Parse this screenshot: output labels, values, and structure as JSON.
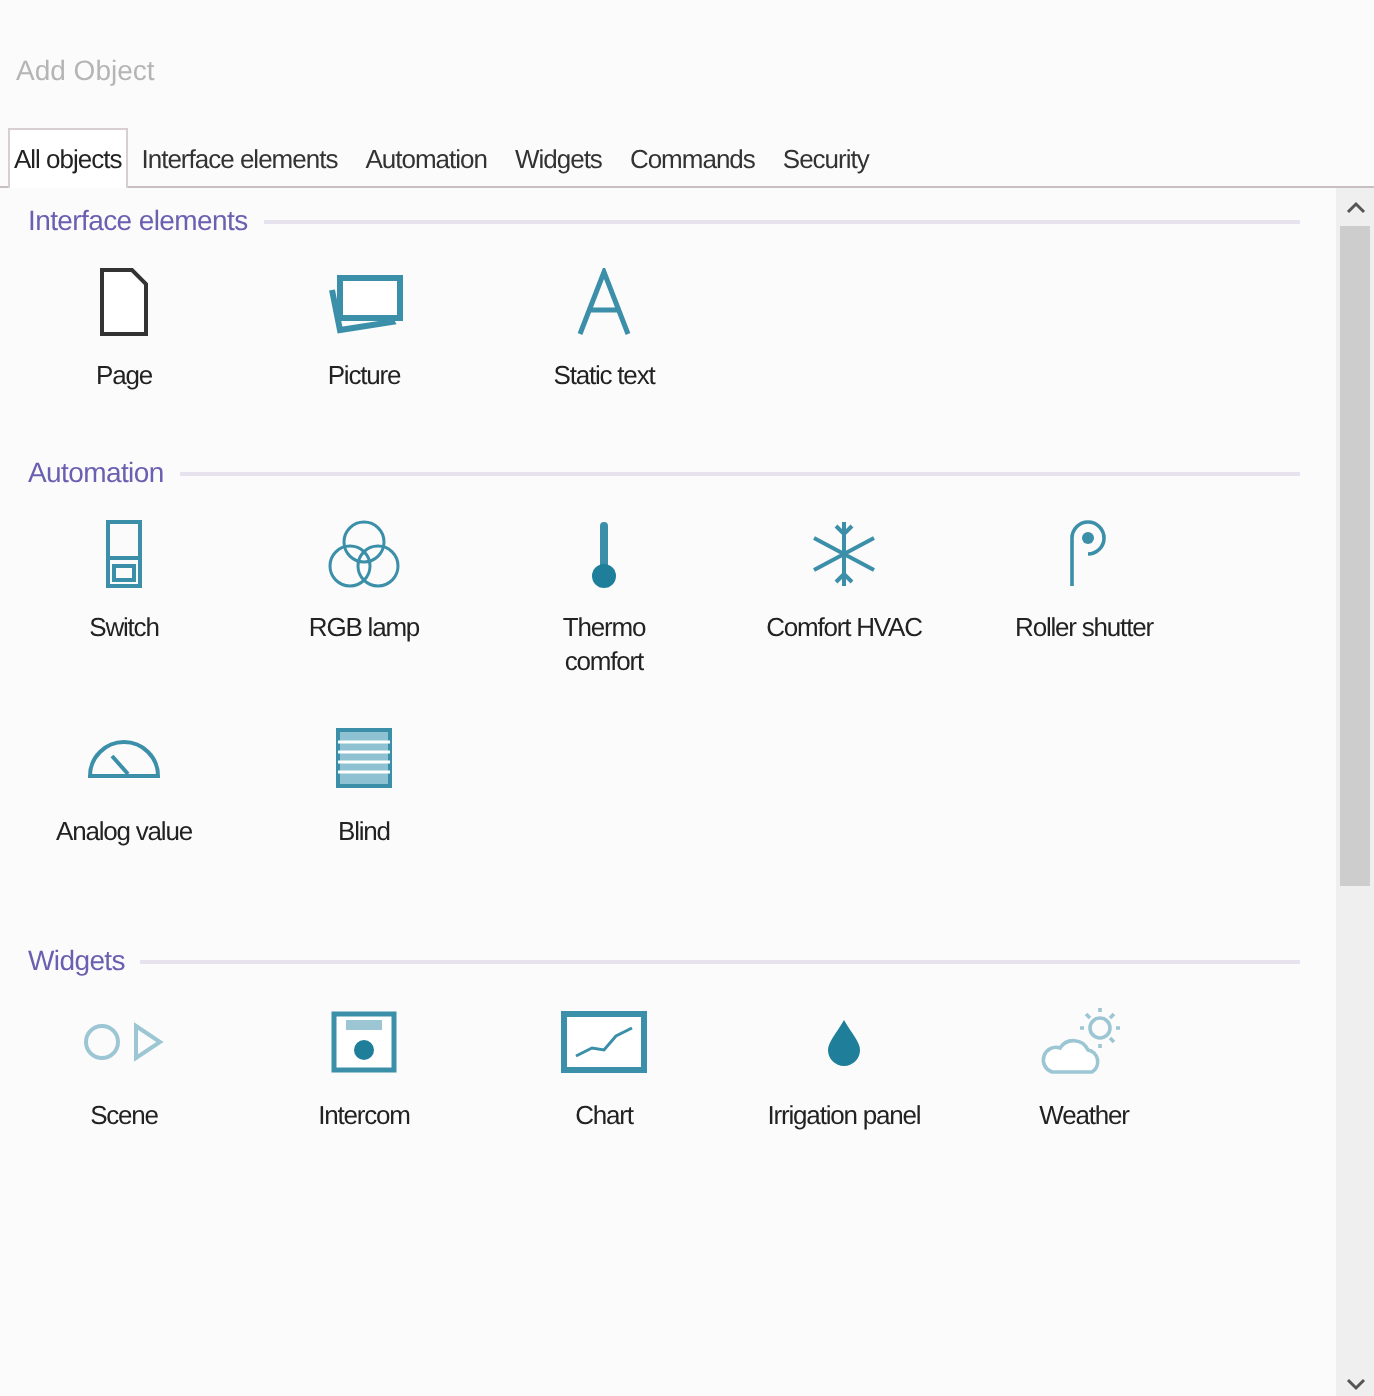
{
  "window": {
    "title": "Add Object"
  },
  "tabs": [
    {
      "label": "All objects",
      "selected": true
    },
    {
      "label": "Interface elements",
      "selected": false
    },
    {
      "label": "Automation",
      "selected": false
    },
    {
      "label": "Widgets",
      "selected": false
    },
    {
      "label": "Commands",
      "selected": false
    },
    {
      "label": "Security",
      "selected": false
    }
  ],
  "sections": [
    {
      "title": "Interface elements",
      "items": [
        {
          "label": "Page"
        },
        {
          "label": "Picture"
        },
        {
          "label": "Static text"
        }
      ]
    },
    {
      "title": "Automation",
      "items": [
        {
          "label": "Switch"
        },
        {
          "label": "RGB lamp"
        },
        {
          "label": "Thermo\ncomfort"
        },
        {
          "label": "Comfort HVAC"
        },
        {
          "label": "Roller shutter"
        },
        {
          "label": "Analog value"
        },
        {
          "label": "Blind"
        }
      ]
    },
    {
      "title": "Widgets",
      "items": [
        {
          "label": "Scene"
        },
        {
          "label": "Intercom"
        },
        {
          "label": "Chart"
        },
        {
          "label": "Irrigation panel"
        },
        {
          "label": "Weather"
        }
      ]
    }
  ]
}
